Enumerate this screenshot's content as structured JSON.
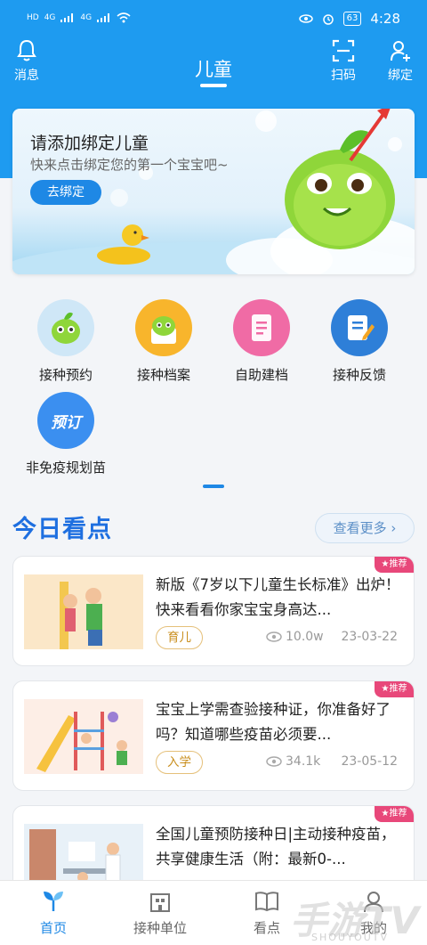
{
  "status_bar": {
    "left": [
      "HD",
      "4G",
      "4G"
    ],
    "battery": "63",
    "time": "4:28"
  },
  "top_nav": {
    "left_label": "消息",
    "title": "儿童",
    "scan_label": "扫码",
    "bind_label": "绑定"
  },
  "banner": {
    "title": "请添加绑定儿童",
    "subtitle": "快来点击绑定您的第一个宝宝吧~",
    "button": "去绑定"
  },
  "menu": [
    {
      "label": "接种预约",
      "icon": "mascot-icon",
      "color": "#cfe7f7"
    },
    {
      "label": "接种档案",
      "icon": "mascot-file-icon",
      "color": "#f8b52c"
    },
    {
      "label": "自助建档",
      "icon": "document-icon",
      "color": "#f06ba5"
    },
    {
      "label": "接种反馈",
      "icon": "feedback-icon",
      "color": "#2e7fd8"
    },
    {
      "label": "非免疫规划苗",
      "icon": "order-icon",
      "color": "#3b8ff0",
      "icon_text": "预订"
    }
  ],
  "section": {
    "title": "今日看点",
    "more": "查看更多 ›"
  },
  "articles": [
    {
      "title": "新版《7岁以下儿童生长标准》出炉！快来看看你家宝宝身高达...",
      "tag": "育儿",
      "views": "10.0w",
      "date": "23-03-22",
      "badge": "★推荐"
    },
    {
      "title": "宝宝上学需查验接种证，你准备好了吗？知道哪些疫苗必须要...",
      "tag": "入学",
      "views": "34.1k",
      "date": "23-05-12",
      "badge": "★推荐"
    },
    {
      "title": "全国儿童预防接种日|主动接种疫苗，共享健康生活（附：最新0-...",
      "tag": "",
      "views": "",
      "date": "",
      "badge": "★推荐"
    }
  ],
  "tabbar": [
    {
      "label": "首页",
      "active": true
    },
    {
      "label": "接种单位",
      "active": false
    },
    {
      "label": "看点",
      "active": false
    },
    {
      "label": "我的",
      "active": false
    }
  ],
  "watermark": {
    "text": "手游TV",
    "sub": "SHOUYOUTV"
  },
  "colors": {
    "brand_blue": "#1e9bf0",
    "accent_blue": "#1e88e5",
    "tag_gold": "#c98e1c",
    "badge_pink": "#e8487a"
  }
}
